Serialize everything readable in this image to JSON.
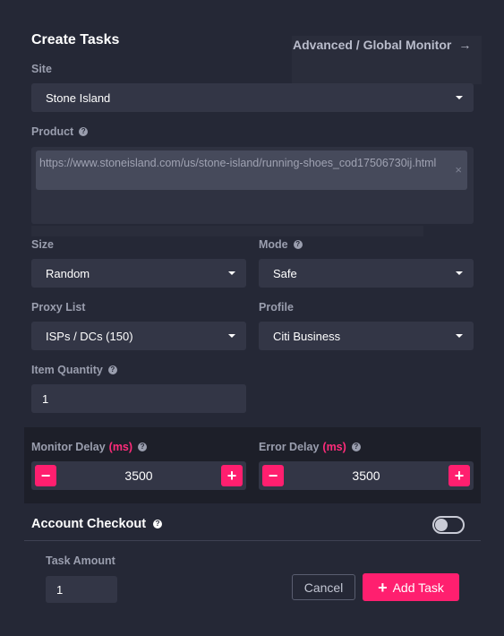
{
  "header": {
    "title": "Create Tasks",
    "advanced_link": "Advanced / Global Monitor"
  },
  "fields": {
    "site": {
      "label": "Site",
      "value": "Stone Island"
    },
    "product": {
      "label": "Product",
      "value": "https://www.stoneisland.com/us/stone-island/running-shoes_cod17506730ij.html"
    },
    "size": {
      "label": "Size",
      "value": "Random"
    },
    "mode": {
      "label": "Mode",
      "value": "Safe"
    },
    "proxy_list": {
      "label": "Proxy List",
      "value": "ISPs / DCs (150)"
    },
    "profile": {
      "label": "Profile",
      "value": "Citi Business"
    },
    "item_quantity": {
      "label": "Item Quantity",
      "value": "1"
    }
  },
  "delays": {
    "monitor": {
      "label": "Monitor Delay",
      "unit": "(ms)",
      "value": "3500"
    },
    "error": {
      "label": "Error Delay",
      "unit": "(ms)",
      "value": "3500"
    }
  },
  "account_checkout": {
    "label": "Account Checkout",
    "enabled": false
  },
  "footer": {
    "task_amount_label": "Task Amount",
    "task_amount_value": "1",
    "cancel_label": "Cancel",
    "add_task_label": "Add Task"
  },
  "icons": {
    "help": "?",
    "arrow": "→",
    "clear": "×",
    "minus": "−",
    "plus": "+"
  },
  "colors": {
    "accent": "#ff1f6f",
    "background": "#252836",
    "field": "#333646"
  }
}
